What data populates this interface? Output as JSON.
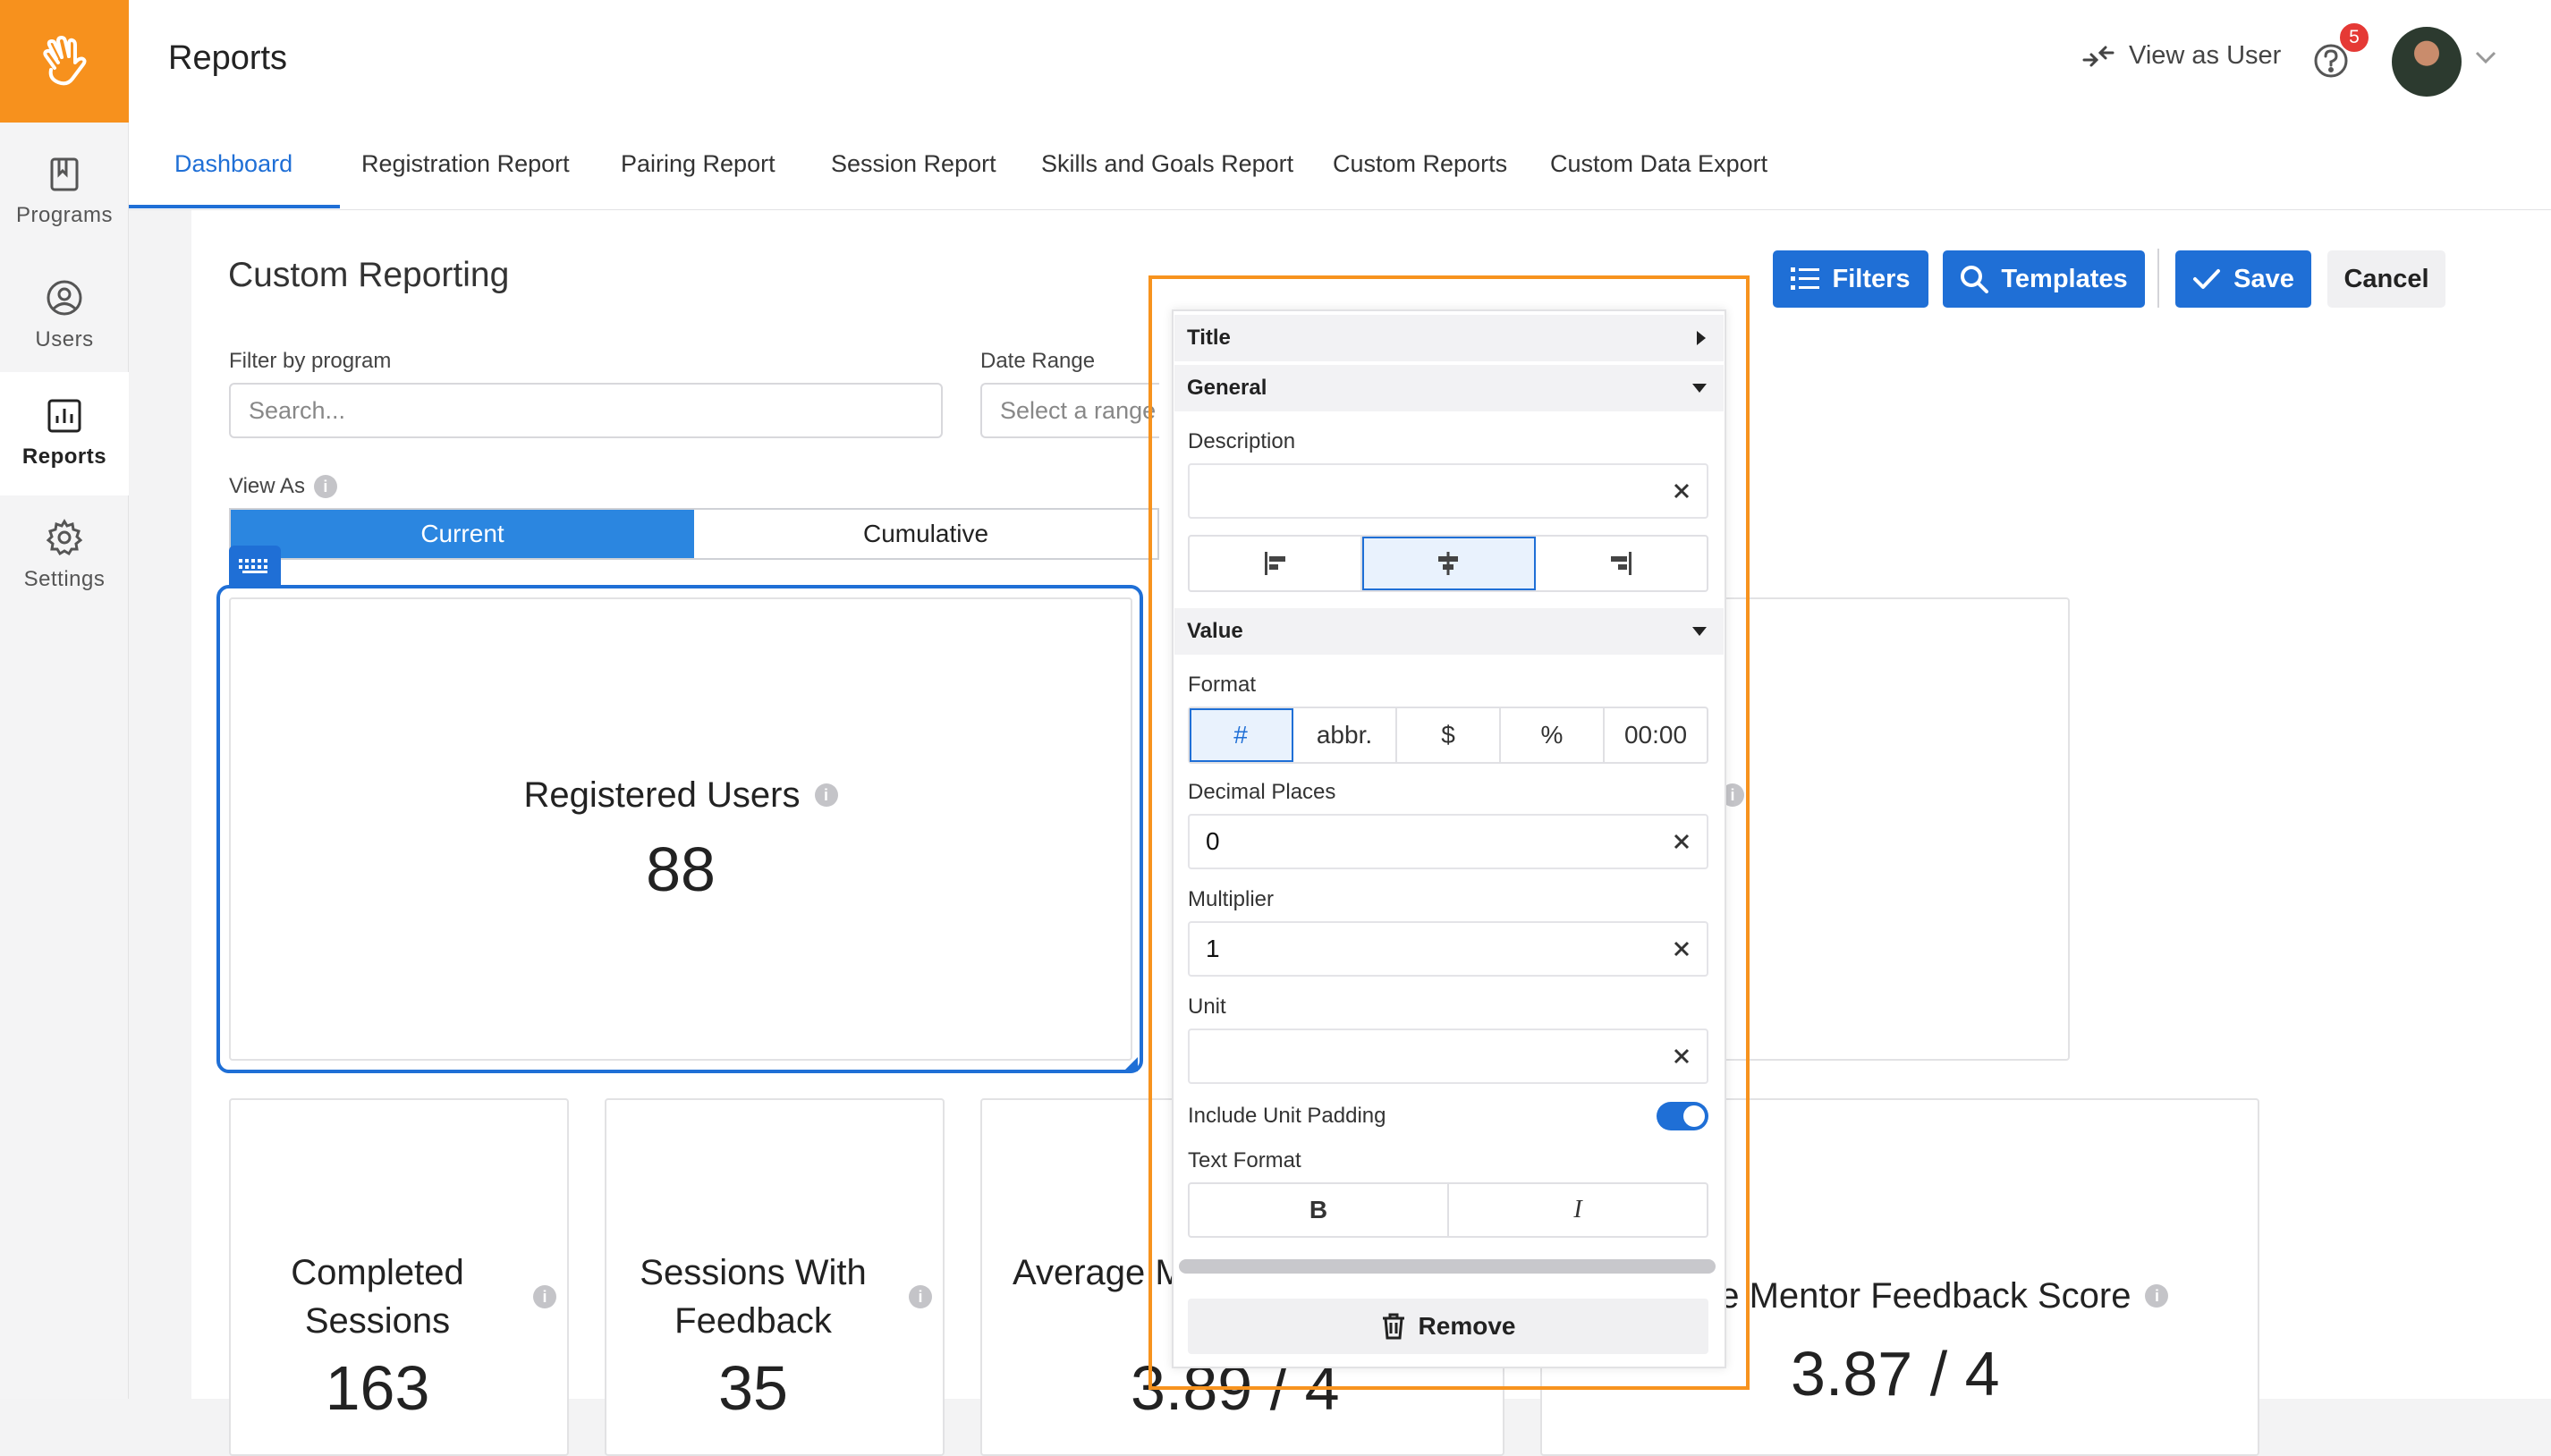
{
  "app": {
    "title": "Reports"
  },
  "sidebar": {
    "items": [
      {
        "label": "Programs",
        "icon": "book-icon"
      },
      {
        "label": "Users",
        "icon": "user-circle-icon"
      },
      {
        "label": "Reports",
        "icon": "bar-chart-icon",
        "active": true
      },
      {
        "label": "Settings",
        "icon": "gear-icon"
      }
    ]
  },
  "header": {
    "view_as_user": "View as User",
    "notification_count": "5"
  },
  "tabs": [
    {
      "label": "Dashboard",
      "active": true
    },
    {
      "label": "Registration Report"
    },
    {
      "label": "Pairing Report"
    },
    {
      "label": "Session Report"
    },
    {
      "label": "Skills and Goals Report"
    },
    {
      "label": "Custom Reports"
    },
    {
      "label": "Custom Data Export"
    }
  ],
  "page": {
    "title": "Custom Reporting",
    "filter_label": "Filter by program",
    "search_placeholder": "Search...",
    "date_range_label": "Date Range",
    "date_range_placeholder": "Select a range",
    "view_as_label": "View As",
    "view_as_options": [
      "Current",
      "Cumulative"
    ],
    "view_as_selected": "Current"
  },
  "toolbar": {
    "filters": "Filters",
    "templates": "Templates",
    "save": "Save",
    "cancel": "Cancel"
  },
  "tiles": {
    "registered_users": {
      "title": "Registered Users",
      "value": "88"
    },
    "completed_sessions": {
      "title_line1": "Completed",
      "title_line2": "Sessions",
      "value": "163"
    },
    "sessions_with_feedback": {
      "title_line1": "Sessions With",
      "title_line2": "Feedback",
      "value": "35"
    },
    "average_mentee_score": {
      "title": "Average M",
      "value": "3.89 / 4"
    },
    "average_mentor_score": {
      "title": "ge Mentor Feedback Score",
      "value": "3.87 / 4"
    }
  },
  "panel": {
    "sections": {
      "title": "Title",
      "general": "General",
      "value": "Value"
    },
    "description_label": "Description",
    "description_value": "",
    "alignment_options": [
      "align-left-icon",
      "align-center-icon",
      "align-right-icon"
    ],
    "alignment_selected": "center",
    "format_label": "Format",
    "format_options": [
      "#",
      "abbr.",
      "$",
      "%",
      "00:00"
    ],
    "format_selected": "#",
    "decimal_label": "Decimal Places",
    "decimal_value": "0",
    "multiplier_label": "Multiplier",
    "multiplier_value": "1",
    "unit_label": "Unit",
    "unit_value": "",
    "unit_padding_label": "Include Unit Padding",
    "unit_padding_on": true,
    "text_format_label": "Text Format",
    "text_format_options": [
      "B",
      "I"
    ],
    "remove": "Remove"
  },
  "colors": {
    "brand_orange": "#f7911d",
    "accent_blue": "#1f6fd6",
    "segment_blue": "#2b86e0",
    "badge_red": "#e53935",
    "highlight_orange": "#f7931e"
  }
}
